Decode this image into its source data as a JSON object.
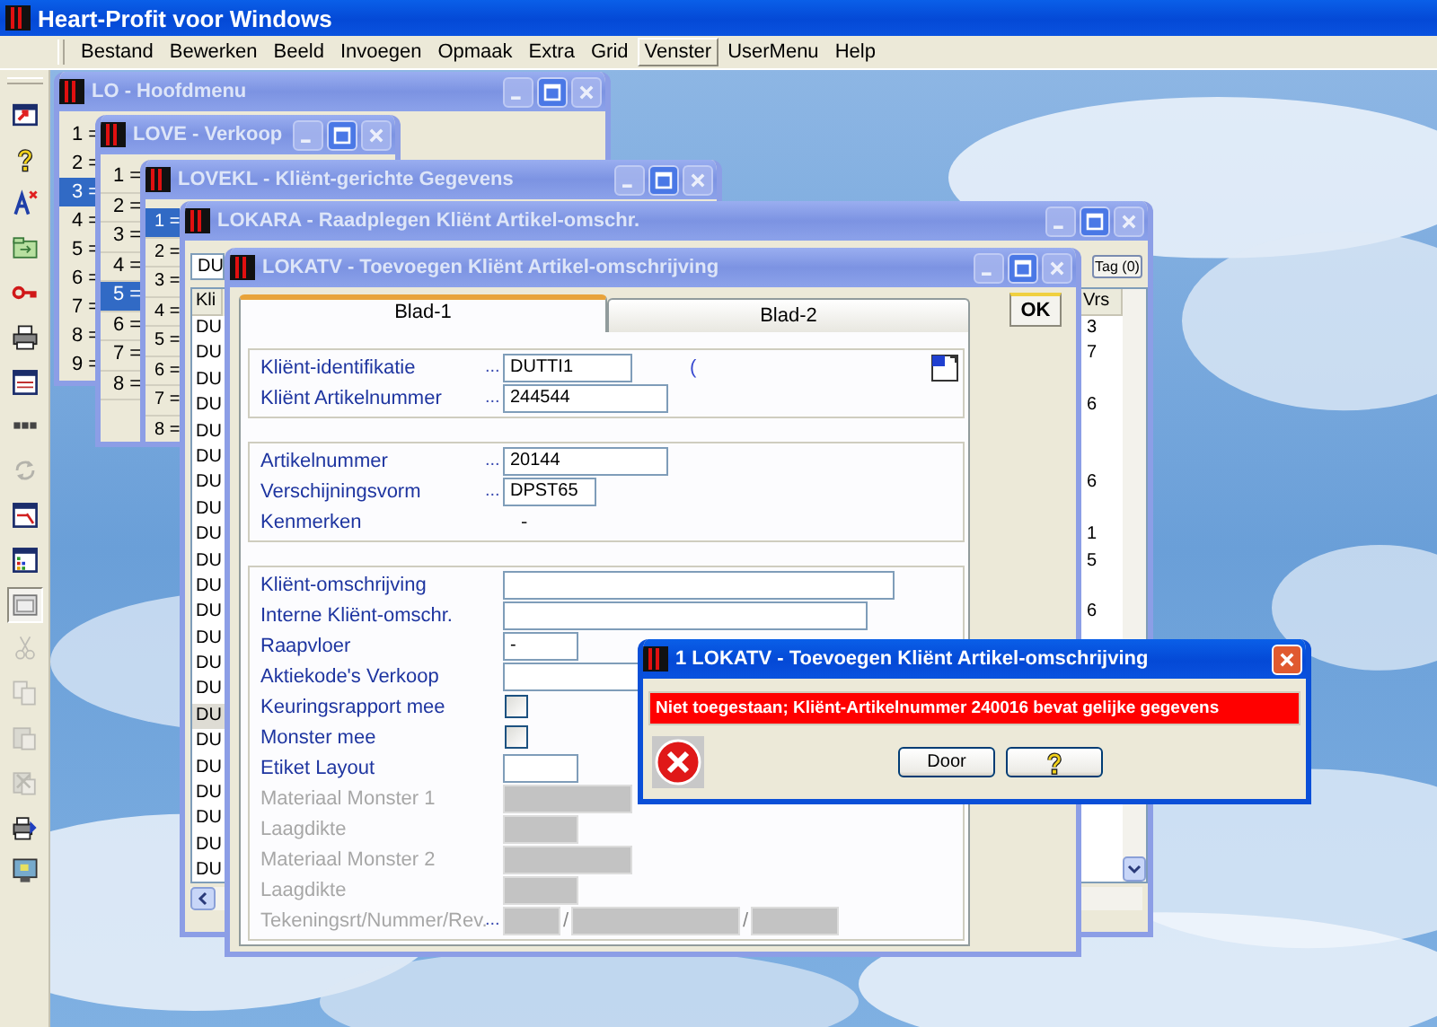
{
  "app": {
    "title": "Heart-Profit voor Windows"
  },
  "menu": [
    {
      "label": "Bestand",
      "selected": false
    },
    {
      "label": "Bewerken",
      "selected": false
    },
    {
      "label": "Beeld",
      "selected": false
    },
    {
      "label": "Invoegen",
      "selected": false
    },
    {
      "label": "Opmaak",
      "selected": false
    },
    {
      "label": "Extra",
      "selected": false
    },
    {
      "label": "Grid",
      "selected": false
    },
    {
      "label": "Venster",
      "selected": true
    },
    {
      "label": "UserMenu",
      "selected": false
    },
    {
      "label": "Help",
      "selected": false
    }
  ],
  "toolbar": [
    {
      "kind": "window-arrow",
      "disabled": false,
      "pressed": false
    },
    {
      "kind": "help",
      "disabled": false,
      "pressed": false
    },
    {
      "kind": "font-delete",
      "disabled": false,
      "pressed": false
    },
    {
      "kind": "folder",
      "disabled": false,
      "pressed": false
    },
    {
      "kind": "key",
      "disabled": false,
      "pressed": false
    },
    {
      "kind": "printer",
      "disabled": false,
      "pressed": false
    },
    {
      "kind": "form",
      "disabled": false,
      "pressed": false
    },
    {
      "kind": "dots",
      "disabled": false,
      "pressed": false
    },
    {
      "kind": "refresh",
      "disabled": true,
      "pressed": false
    },
    {
      "kind": "form-edit",
      "disabled": false,
      "pressed": false
    },
    {
      "kind": "chart",
      "disabled": false,
      "pressed": false
    },
    {
      "kind": "window",
      "disabled": false,
      "pressed": true
    },
    {
      "kind": "cut",
      "disabled": true,
      "pressed": false
    },
    {
      "kind": "copy",
      "disabled": true,
      "pressed": false
    },
    {
      "kind": "paste",
      "disabled": true,
      "pressed": false
    },
    {
      "kind": "paste-delete",
      "disabled": true,
      "pressed": false
    },
    {
      "kind": "print-setup",
      "disabled": false,
      "pressed": false
    },
    {
      "kind": "monitor",
      "disabled": false,
      "pressed": false
    }
  ],
  "windows": [
    {
      "kind": "menu",
      "title": "LO - Hoofdmenu",
      "active": false,
      "items": [
        {
          "label": "1 =",
          "selected": false
        },
        {
          "label": "2 =",
          "selected": false
        },
        {
          "label": "3 =",
          "selected": true
        },
        {
          "label": "4 =",
          "selected": false
        },
        {
          "label": "5 =",
          "selected": false
        },
        {
          "label": "6 =",
          "selected": false
        },
        {
          "label": "7 =",
          "selected": false
        },
        {
          "label": "8 =",
          "selected": false
        },
        {
          "label": "9 =",
          "selected": false
        }
      ]
    },
    {
      "kind": "menu",
      "title": "LOVE - Verkoop",
      "active": false,
      "items": [
        {
          "label": "1 =",
          "selected": false
        },
        {
          "label": "2 =",
          "selected": false
        },
        {
          "label": "3 =",
          "selected": false
        },
        {
          "label": "4 =",
          "selected": false
        },
        {
          "label": "5 =",
          "selected": true
        },
        {
          "label": "6 =",
          "selected": false
        },
        {
          "label": "7 =",
          "selected": false
        },
        {
          "label": "8 =",
          "selected": false
        }
      ]
    },
    {
      "kind": "menu",
      "title": "LOVEKL - Kliënt-gerichte Gegevens",
      "active": false,
      "items": [
        {
          "label": "1 =",
          "selected": true
        },
        {
          "label": "2 =",
          "selected": false
        },
        {
          "label": "3 =",
          "selected": false
        },
        {
          "label": "4 =",
          "selected": false
        },
        {
          "label": "5 =",
          "selected": false
        },
        {
          "label": "6 =",
          "selected": false
        },
        {
          "label": "7 =",
          "selected": false
        },
        {
          "label": "8 =",
          "selected": false
        }
      ]
    },
    {
      "kind": "table",
      "title": "LOKARA - Raadplegen Kliënt Artikel-omschr.",
      "active": false,
      "filter": "DU",
      "tag_button": "Tag (0)",
      "columns": [
        "Kli",
        "Vrs"
      ],
      "rows": [
        {
          "cells": [
            "DU",
            "3"
          ],
          "selected": false
        },
        {
          "cells": [
            "DU",
            "7"
          ],
          "selected": false
        },
        {
          "cells": [
            "DU"
          ],
          "selected": false
        },
        {
          "cells": [
            "DU",
            "6"
          ],
          "selected": false
        },
        {
          "cells": [
            "DU"
          ],
          "selected": false
        },
        {
          "cells": [
            "DU"
          ],
          "selected": false
        },
        {
          "cells": [
            "DU",
            "6"
          ],
          "selected": false
        },
        {
          "cells": [
            "DU"
          ],
          "selected": false
        },
        {
          "cells": [
            "DU",
            "1"
          ],
          "selected": false
        },
        {
          "cells": [
            "DU",
            "5"
          ],
          "selected": false
        },
        {
          "cells": [
            "DU"
          ],
          "selected": false
        },
        {
          "cells": [
            "DU",
            "6"
          ],
          "selected": false
        },
        {
          "cells": [
            "DU"
          ],
          "selected": false
        },
        {
          "cells": [
            "DU"
          ],
          "selected": false
        },
        {
          "cells": [
            "DU"
          ],
          "selected": false
        },
        {
          "cells": [
            "DU"
          ],
          "selected": true
        },
        {
          "cells": [
            "DU"
          ],
          "selected": false
        },
        {
          "cells": [
            "DU"
          ],
          "selected": false
        },
        {
          "cells": [
            "DU"
          ],
          "selected": false
        },
        {
          "cells": [
            "DU"
          ],
          "selected": false
        },
        {
          "cells": [
            "DU"
          ],
          "selected": false
        },
        {
          "cells": [
            "DU"
          ],
          "selected": false
        }
      ]
    },
    {
      "kind": "form",
      "title": "LOKATV - Toevoegen Kliënt Artikel-omschrijving",
      "active": false,
      "tabs": [
        {
          "label": "Blad-1",
          "selected": true
        },
        {
          "label": "Blad-2",
          "selected": false
        }
      ],
      "ok_button": "OK",
      "groups": [
        {
          "rows": [
            {
              "kind": "text",
              "label": "Kliënt-identifikatie",
              "dots": "...",
              "value": "DUTTI1",
              "lookup_text": "(",
              "disabled": false
            },
            {
              "kind": "text",
              "label": "Kliënt Artikelnummer",
              "dots": "...",
              "value": "244544",
              "disabled": false
            }
          ]
        },
        {
          "rows": [
            {
              "kind": "text",
              "label": "Artikelnummer",
              "dots": "...",
              "value": "20144",
              "disabled": false
            },
            {
              "kind": "text",
              "label": "Verschijningsvorm",
              "dots": "...",
              "value": "DPST65",
              "disabled": false
            },
            {
              "kind": "static",
              "label": "Kenmerken",
              "value": "-",
              "disabled": false
            }
          ]
        },
        {
          "rows": [
            {
              "kind": "text",
              "label": "Kliënt-omschrijving",
              "disabled": false
            },
            {
              "kind": "text",
              "label": "Interne Kliënt-omschr.",
              "disabled": false
            },
            {
              "kind": "text",
              "label": "Raapvloer",
              "value": "-",
              "disabled": false
            },
            {
              "kind": "text",
              "label": "Aktiekode's Verkoop",
              "disabled": false
            },
            {
              "kind": "check",
              "label": "Keuringsrapport mee",
              "checked": false,
              "disabled": false
            },
            {
              "kind": "check",
              "label": "Monster mee",
              "checked": false,
              "disabled": false
            },
            {
              "kind": "text",
              "label": "Etiket Layout",
              "disabled": false
            },
            {
              "kind": "text",
              "label": "Materiaal Monster 1",
              "disabled": true
            },
            {
              "kind": "text",
              "label": "Laagdikte",
              "disabled": true
            },
            {
              "kind": "text",
              "label": "Materiaal Monster 2",
              "disabled": true
            },
            {
              "kind": "text",
              "label": "Laagdikte",
              "disabled": true
            },
            {
              "kind": "multi",
              "label": "Tekeningsrt/Nummer/Rev.",
              "dots": "...",
              "separators": [
                "/",
                "/"
              ],
              "disabled": true
            }
          ]
        }
      ]
    }
  ],
  "dialog": {
    "title": "1 LOKATV - Toevoegen Kliënt Artikel-omschrijving",
    "active": true,
    "message": "Niet toegestaan; Kliënt-Artikelnummer 240016 bevat gelijke gegevens",
    "buttons": [
      {
        "kind": "text",
        "label": "Door"
      },
      {
        "kind": "help"
      }
    ]
  }
}
